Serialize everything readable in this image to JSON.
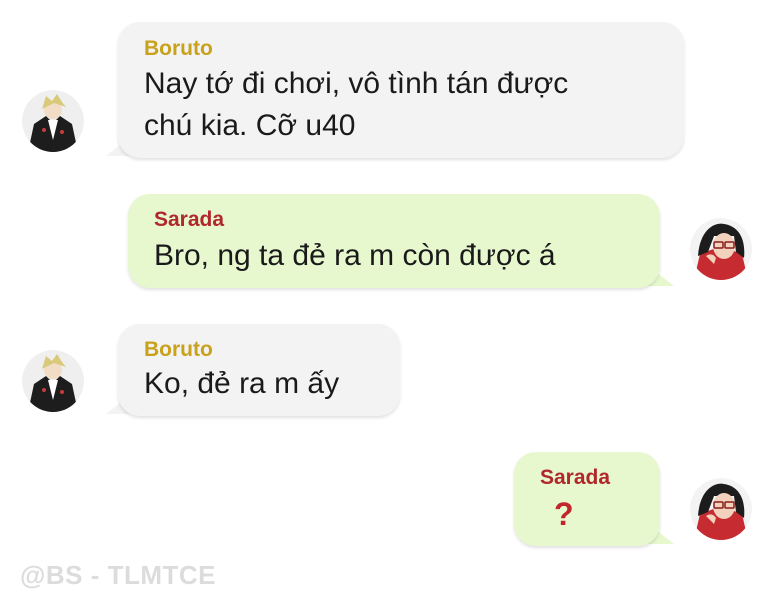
{
  "colors": {
    "boruto_name": "#c9a21c",
    "sarada_name": "#b0282c",
    "incoming_bubble": "#f3f3f3",
    "outgoing_bubble": "#e7f8cf"
  },
  "messages": [
    {
      "sender": "Boruto",
      "side": "incoming",
      "lines": [
        "Nay tớ đi chơi, vô tình tán được",
        "chú kia. Cỡ u40"
      ]
    },
    {
      "sender": "Sarada",
      "side": "outgoing",
      "lines": [
        "Bro, ng ta đẻ ra m còn được á"
      ]
    },
    {
      "sender": "Boruto",
      "side": "incoming",
      "lines": [
        "Ko, đẻ ra m ấy"
      ]
    },
    {
      "sender": "Sarada",
      "side": "outgoing",
      "lines": [
        "?"
      ]
    }
  ],
  "watermark": "@BS - TLMTCE"
}
